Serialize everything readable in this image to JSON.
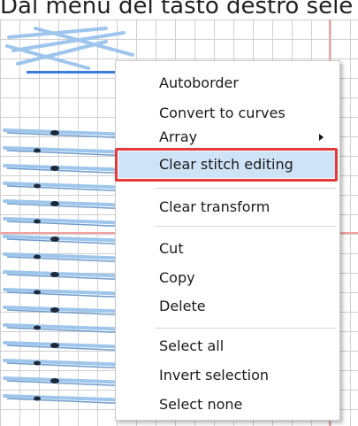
{
  "caption": {
    "text": "Dal menù del tasto destro sele"
  },
  "colors": {
    "guide": "#f3a0a0",
    "stitch": "#9ec6ec",
    "highlight": "#cfe3f7",
    "callout": "#e53939",
    "selection_line": "#3d7be0"
  },
  "context_menu": {
    "items": [
      {
        "label": "Autoborder"
      },
      {
        "label": "Convert to curves"
      },
      {
        "label": "Array",
        "has_submenu": true
      },
      {
        "label": "Clear stitch editing",
        "highlighted": true
      },
      {
        "label": "Clear transform"
      },
      {
        "label": "Cut"
      },
      {
        "label": "Copy"
      },
      {
        "label": "Delete"
      },
      {
        "label": "Select all"
      },
      {
        "label": "Invert selection"
      },
      {
        "label": "Select none"
      }
    ]
  }
}
